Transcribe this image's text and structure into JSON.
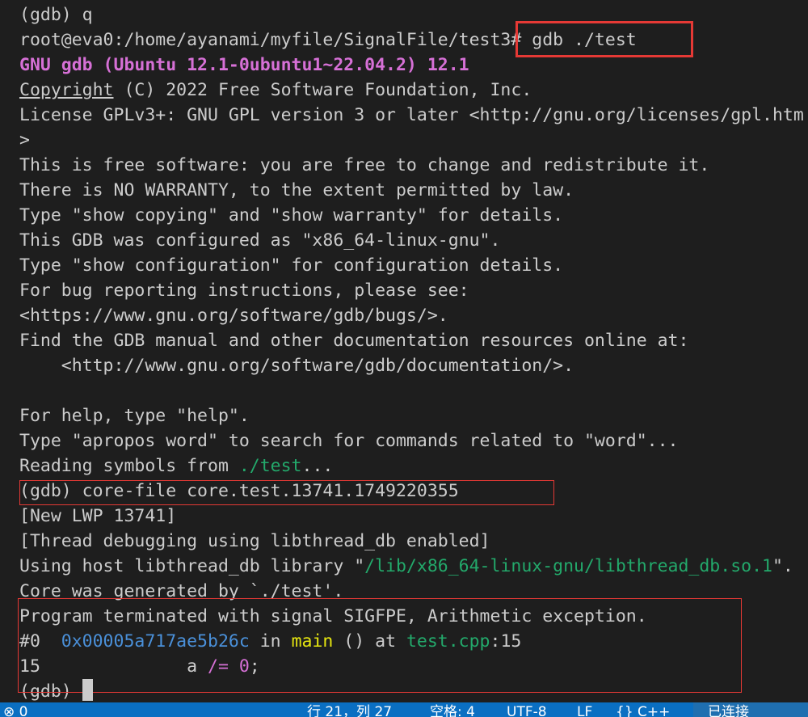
{
  "terminal": {
    "lines": [
      [
        {
          "t": "(gdb) q"
        }
      ],
      [
        {
          "t": "root@eva0:/home/ayanami/myfile/SignalFile/test3# gdb ./test"
        }
      ],
      [
        {
          "t": "GNU gdb (Ubuntu 12.1-0ubuntu1~22.04.2) 12.1",
          "c": "magenta-bold"
        }
      ],
      [
        {
          "t": "Copyright",
          "u": true
        },
        {
          "t": " (C) 2022 Free Software Foundation, Inc."
        }
      ],
      [
        {
          "t": "License GPLv3+: GNU GPL version 3 or later <http://gnu.org/licenses/gpl.htm"
        }
      ],
      [
        {
          "t": ">"
        }
      ],
      [
        {
          "t": "This is free software: you are free to change and redistribute it."
        }
      ],
      [
        {
          "t": "There is NO WARRANTY, to the extent permitted by law."
        }
      ],
      [
        {
          "t": "Type \"show copying\" and \"show warranty\" for details."
        }
      ],
      [
        {
          "t": "This GDB was configured as \"x86_64-linux-gnu\"."
        }
      ],
      [
        {
          "t": "Type \"show configuration\" for configuration details."
        }
      ],
      [
        {
          "t": "For bug reporting instructions, please see:"
        }
      ],
      [
        {
          "t": "<https://www.gnu.org/software/gdb/bugs/>."
        }
      ],
      [
        {
          "t": "Find the GDB manual and other documentation resources online at:"
        }
      ],
      [
        {
          "t": "    <http://www.gnu.org/software/gdb/documentation/>."
        }
      ],
      [
        {
          "t": ""
        }
      ],
      [
        {
          "t": "For help, type \"help\"."
        }
      ],
      [
        {
          "t": "Type \"apropos word\" to search for commands related to \"word\"..."
        }
      ],
      [
        {
          "t": "Reading symbols from "
        },
        {
          "t": "./test",
          "c": "green"
        },
        {
          "t": "..."
        }
      ],
      [
        {
          "t": "(gdb) core-file core.test.13741.1749220355"
        }
      ],
      [
        {
          "t": "[New LWP 13741]"
        }
      ],
      [
        {
          "t": "[Thread debugging using libthread_db enabled]"
        }
      ],
      [
        {
          "t": "Using host libthread_db library \""
        },
        {
          "t": "/lib/x86_64-linux-gnu/libthread_db.so.1",
          "c": "green"
        },
        {
          "t": "\"."
        }
      ],
      [
        {
          "t": "Core was generated by `./test'."
        }
      ],
      [
        {
          "t": "Program terminated with signal SIGFPE, Arithmetic exception."
        }
      ],
      [
        {
          "t": "#0  "
        },
        {
          "t": "0x00005a717ae5b26c",
          "c": "blue"
        },
        {
          "t": " in "
        },
        {
          "t": "main",
          "c": "yellow"
        },
        {
          "t": " () at "
        },
        {
          "t": "test.cpp",
          "c": "green"
        },
        {
          "t": ":15"
        }
      ],
      [
        {
          "t": "15              a "
        },
        {
          "t": "/= 0",
          "c": "magenta"
        },
        {
          "t": ";"
        }
      ],
      [
        {
          "t": "(gdb) "
        }
      ]
    ]
  },
  "statusbar": {
    "items": [
      "⊗ 0",
      "行 21，列 27",
      "空格: 4",
      "UTF-8",
      "LF",
      "{} C++",
      "已连接"
    ]
  }
}
